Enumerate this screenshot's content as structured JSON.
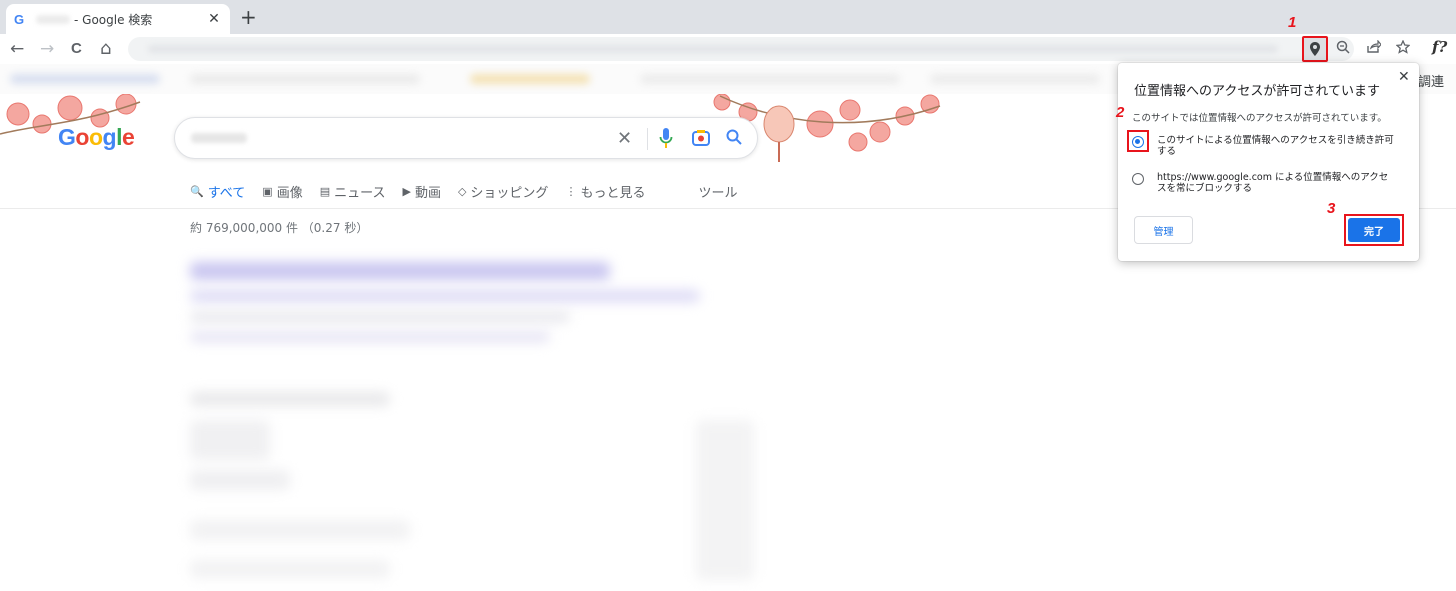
{
  "browser": {
    "tab": {
      "favicon": "G",
      "title": "- Google 検索",
      "close_icon": "close-icon"
    },
    "new_tab_icon": "plus-icon",
    "nav": {
      "back": "←",
      "forward": "→",
      "reload": "C",
      "home": "⌂"
    },
    "toolbar_icons": [
      "location-pin-icon",
      "zoom-icon",
      "share-icon",
      "star-icon"
    ],
    "extension_label": "f?",
    "bookmark_right_text": "調連"
  },
  "google": {
    "logo": "Google",
    "search": {
      "clear_icon": "close-icon"
    },
    "tabs": [
      {
        "icon": "🔍",
        "label": "すべて",
        "active": true
      },
      {
        "icon": "▣",
        "label": "画像",
        "active": false
      },
      {
        "icon": "▤",
        "label": "ニュース",
        "active": false
      },
      {
        "icon": "▶",
        "label": "動画",
        "active": false
      },
      {
        "icon": "◇",
        "label": "ショッピング",
        "active": false
      },
      {
        "icon": "⋮",
        "label": "もっと見る",
        "active": false
      }
    ],
    "tools_label": "ツール",
    "stats": "約 769,000,000 件 （0.27 秒）"
  },
  "location_popup": {
    "title": "位置情報へのアクセスが許可されています",
    "description": "このサイトでは位置情報へのアクセスが許可されています。",
    "options": [
      {
        "label": "このサイトによる位置情報へのアクセスを引き続き許可する",
        "checked": true
      },
      {
        "label": "https://www.google.com による位置情報へのアクセスを常にブロックする",
        "checked": false
      }
    ],
    "manage_label": "管理",
    "done_label": "完了"
  },
  "steps": [
    "1",
    "2",
    "3"
  ],
  "colors": {
    "accent": "#1a73e8",
    "highlight": "#e8141c"
  }
}
